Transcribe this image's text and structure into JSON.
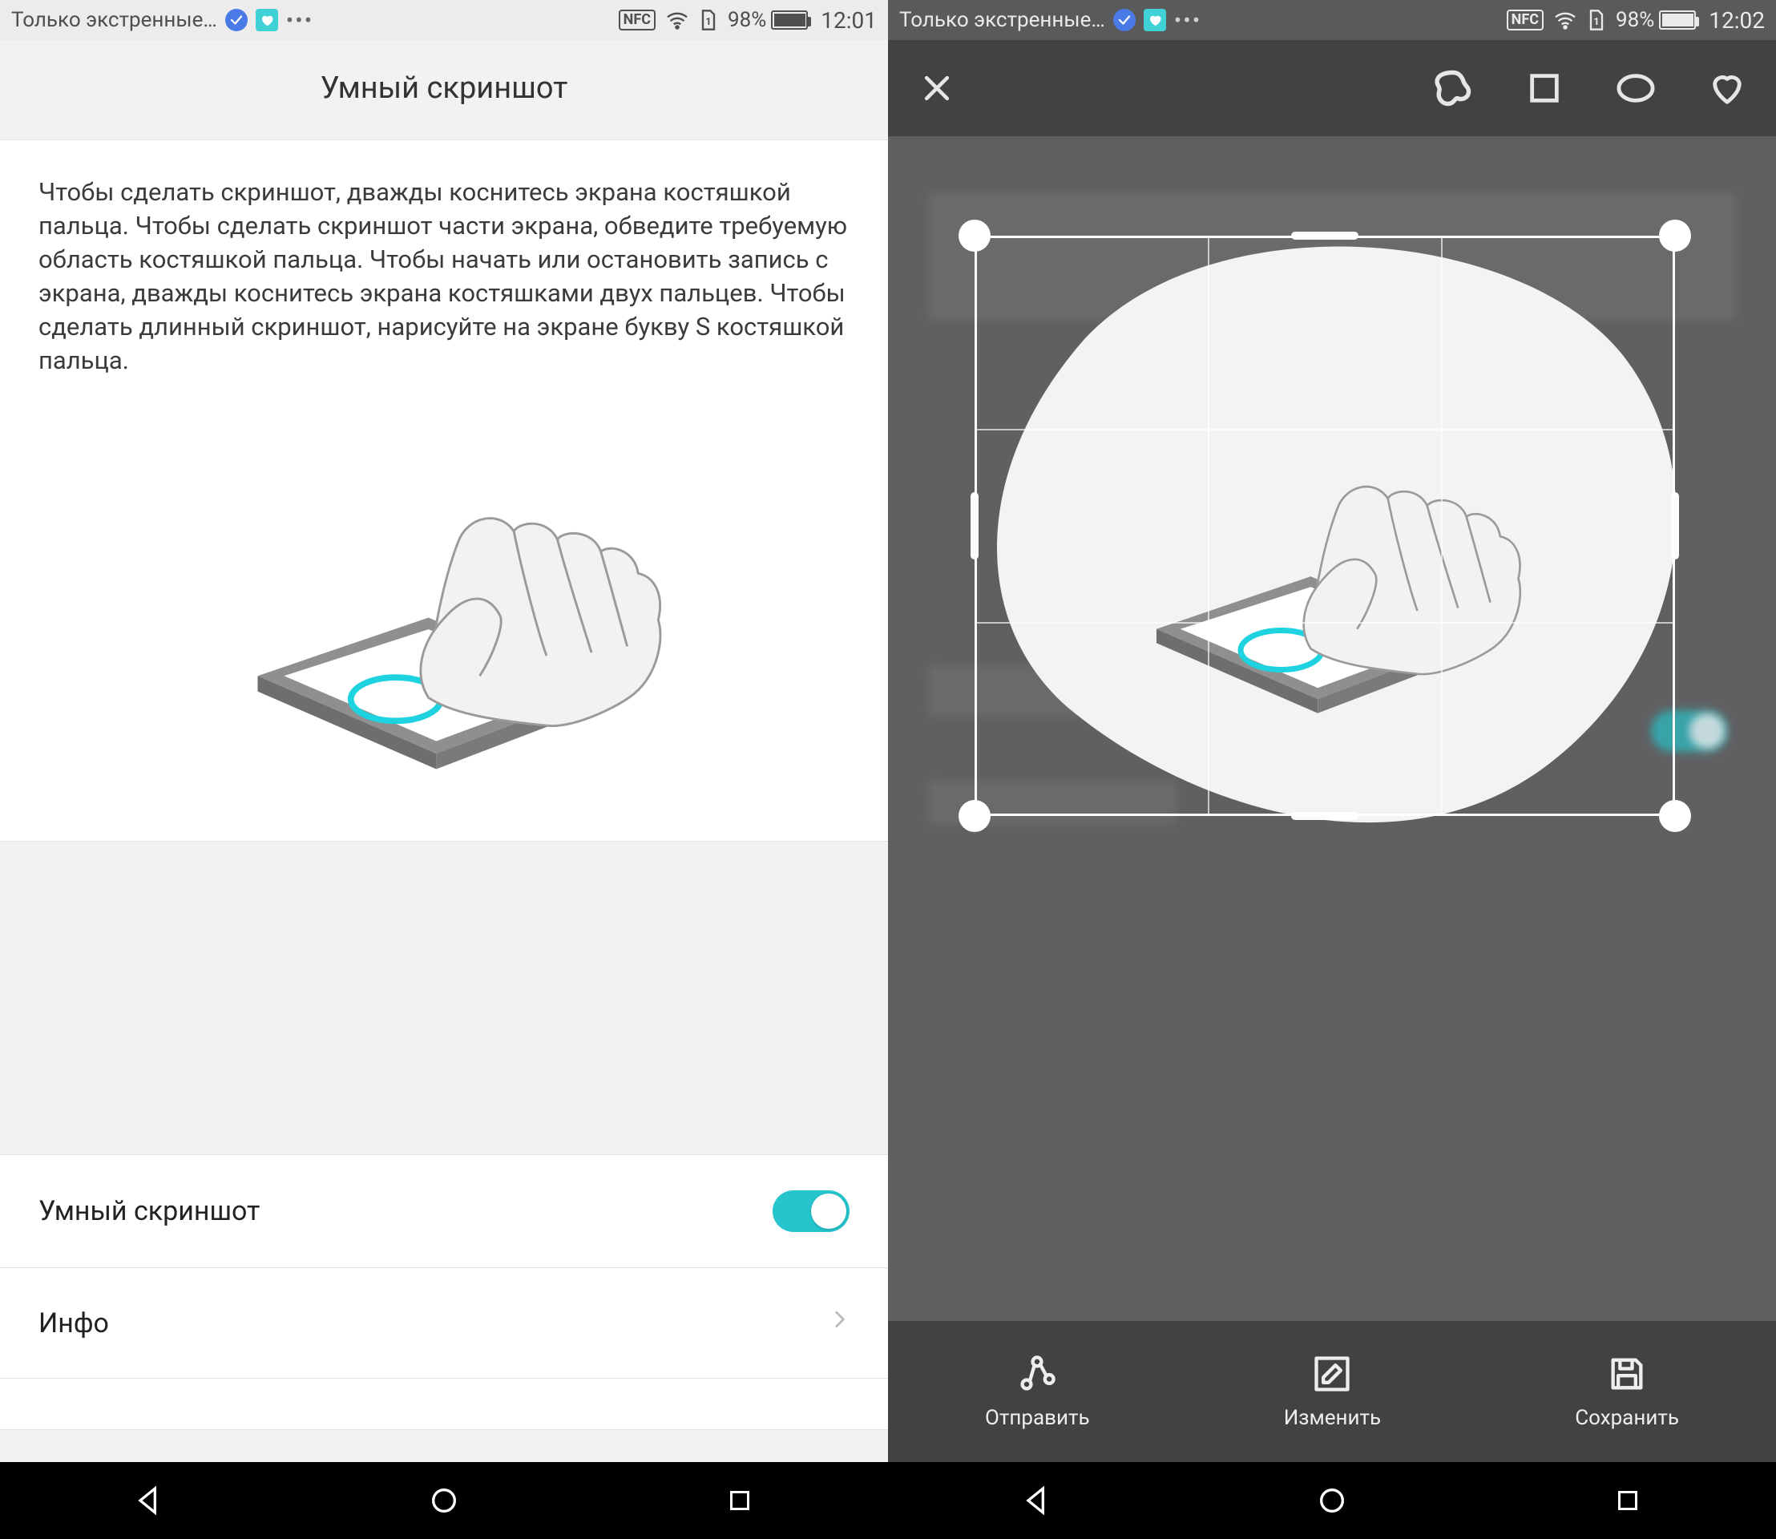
{
  "accent": "#26c4cc",
  "left": {
    "status": {
      "carrier": "Только экстренные…",
      "nfc": "NFC",
      "battery_pct": "98%",
      "battery_level": 0.98,
      "time": "12:01"
    },
    "title": "Умный скриншот",
    "description": "Чтобы сделать скриншот, дважды коснитесь экрана костяшкой пальца. Чтобы сделать скриншот части экрана, обведите требуемую область костяшкой пальца. Чтобы начать или остановить запись с экрана, дважды коснитесь экрана костяшками двух пальцев. Чтобы сделать длинный скриншот, нарисуйте на экране букву S костяшкой пальца.",
    "setting_label": "Умный скриншот",
    "setting_on": true,
    "info_label": "Инфо"
  },
  "right": {
    "status": {
      "carrier": "Только экстренные…",
      "nfc": "NFC",
      "battery_pct": "98%",
      "battery_level": 0.98,
      "time": "12:02"
    },
    "shapes": [
      "freeform",
      "square",
      "oval",
      "heart"
    ],
    "active_shape": "freeform",
    "actions": {
      "share": "Отправить",
      "edit": "Изменить",
      "save": "Сохранить"
    }
  }
}
